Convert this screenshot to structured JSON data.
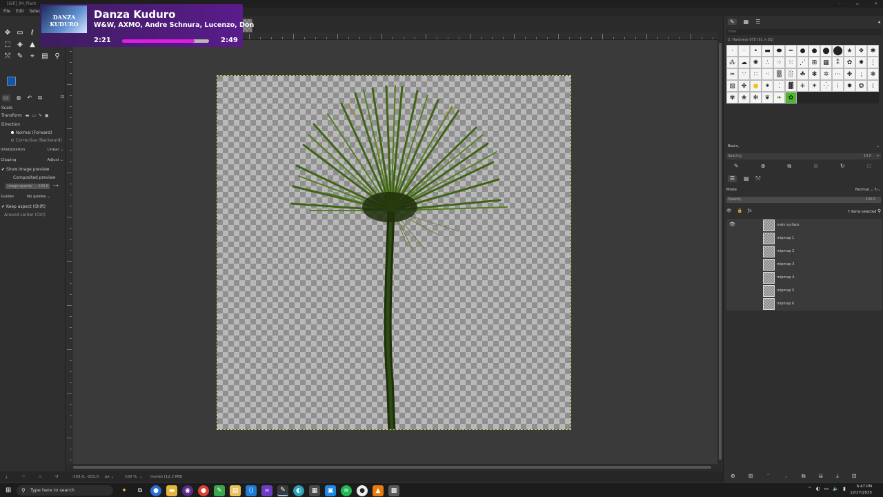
{
  "window": {
    "title": "[Gill]_lM_Plant"
  },
  "menu": [
    "File",
    "Edit",
    "Select"
  ],
  "toolbox": {
    "tools": [
      "move-icon",
      "rect-select-icon",
      "lasso-icon",
      "fuzzy-select-icon",
      "crop-icon",
      "unified-transform-icon",
      "warp-icon",
      "paint-icon",
      "heal-icon",
      "text-icon",
      "paths-icon",
      "color-picker-icon",
      "measure-icon",
      "gradient-icon",
      "zoom-icon"
    ],
    "fg_color": "#0a57b8",
    "options": {
      "title": "Scale",
      "transform_label": "Transform",
      "direction_label": "Direction",
      "direction_normal": "Normal (Forward)",
      "direction_corrective": "Corrective (Backward)",
      "interpolation_label": "Interpolation",
      "interpolation_value": "Linear",
      "clipping_label": "Clipping",
      "clipping_value": "Adjust",
      "show_preview": "Show image preview",
      "composited_preview": "Composited preview",
      "image_opacity_label": "Image opacity",
      "image_opacity_value": "100.0",
      "guides_label": "Guides",
      "guides_value": "No guides",
      "keep_aspect": "Keep aspect (Shift)",
      "around_center": "Around center (Ctrl)"
    }
  },
  "status": {
    "coords": "-103.0, -103.0",
    "unit": "px",
    "zoom": "100 %",
    "info": "(none) (12.2 MB)"
  },
  "brushes": {
    "filter_placeholder": "filter",
    "selected_name": "2. Hardness 075 (51 × 51)",
    "preset": "Basic,",
    "spacing_label": "Spacing",
    "spacing_value": "10.0"
  },
  "layers": {
    "mode_label": "Mode",
    "mode_value": "Normal",
    "opacity_label": "Opacity",
    "opacity_value": "100.0",
    "selected_count": "7 items selected",
    "items": [
      {
        "name": "main surface",
        "visible": true
      },
      {
        "name": "mipmap 1",
        "visible": false
      },
      {
        "name": "mipmap 2",
        "visible": false
      },
      {
        "name": "mipmap 3",
        "visible": false
      },
      {
        "name": "mipmap 4",
        "visible": false
      },
      {
        "name": "mipmap 5",
        "visible": false
      },
      {
        "name": "mipmap 6",
        "visible": false
      }
    ]
  },
  "now_playing": {
    "album_art_text": "DANZA KUDURO",
    "title": "Danza Kuduro",
    "artists": "W&W, AXMO, Andre Schnura, Lucenzo, Don",
    "elapsed": "2:21",
    "total": "2:49",
    "progress": 0.83,
    "accent": "#e01ce0"
  },
  "taskbar": {
    "search_placeholder": "Type here to search",
    "apps": [
      "copilot-icon",
      "task-view-icon",
      "chrome-icon",
      "file-explorer-icon",
      "obs-icon",
      "chrome-2-icon",
      "notepad-plus-icon",
      "files-icon",
      "vscode-icon",
      "visual-studio-icon",
      "gimp-icon",
      "edge-icon",
      "app-icon",
      "photos-icon",
      "spotify-icon",
      "github-icon",
      "blender-icon",
      "game-icon"
    ],
    "time": "6:47 PM",
    "date": "12/27/2025"
  }
}
